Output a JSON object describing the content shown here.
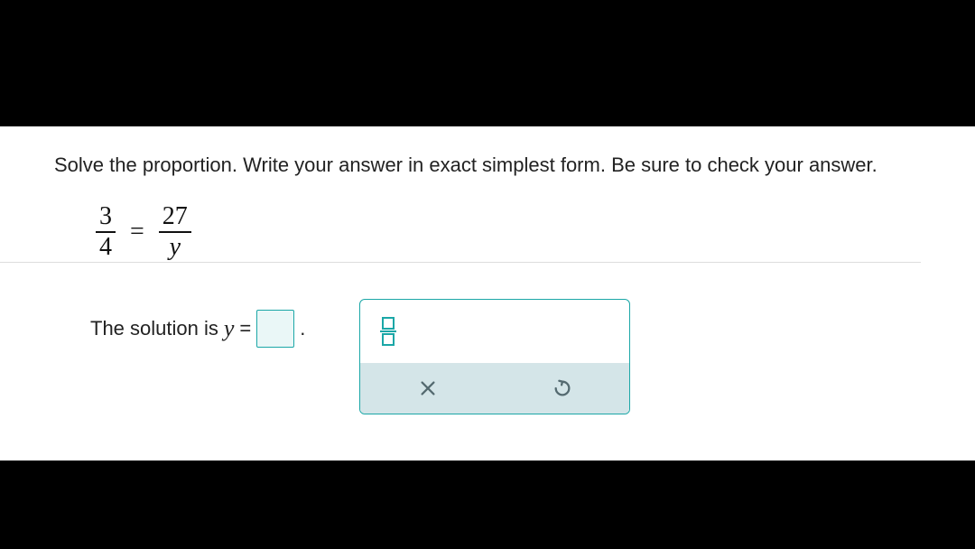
{
  "instruction": "Solve the proportion. Write your answer in exact simplest form. Be sure to check your answer.",
  "equation": {
    "left": {
      "num": "3",
      "den": "4"
    },
    "right": {
      "num": "27",
      "den": "y"
    }
  },
  "solution_prefix": "The solution is ",
  "solution_variable": "y",
  "solution_equals": "=",
  "period": ".",
  "tools": {
    "fraction": "fraction",
    "clear": "clear",
    "undo": "undo"
  }
}
